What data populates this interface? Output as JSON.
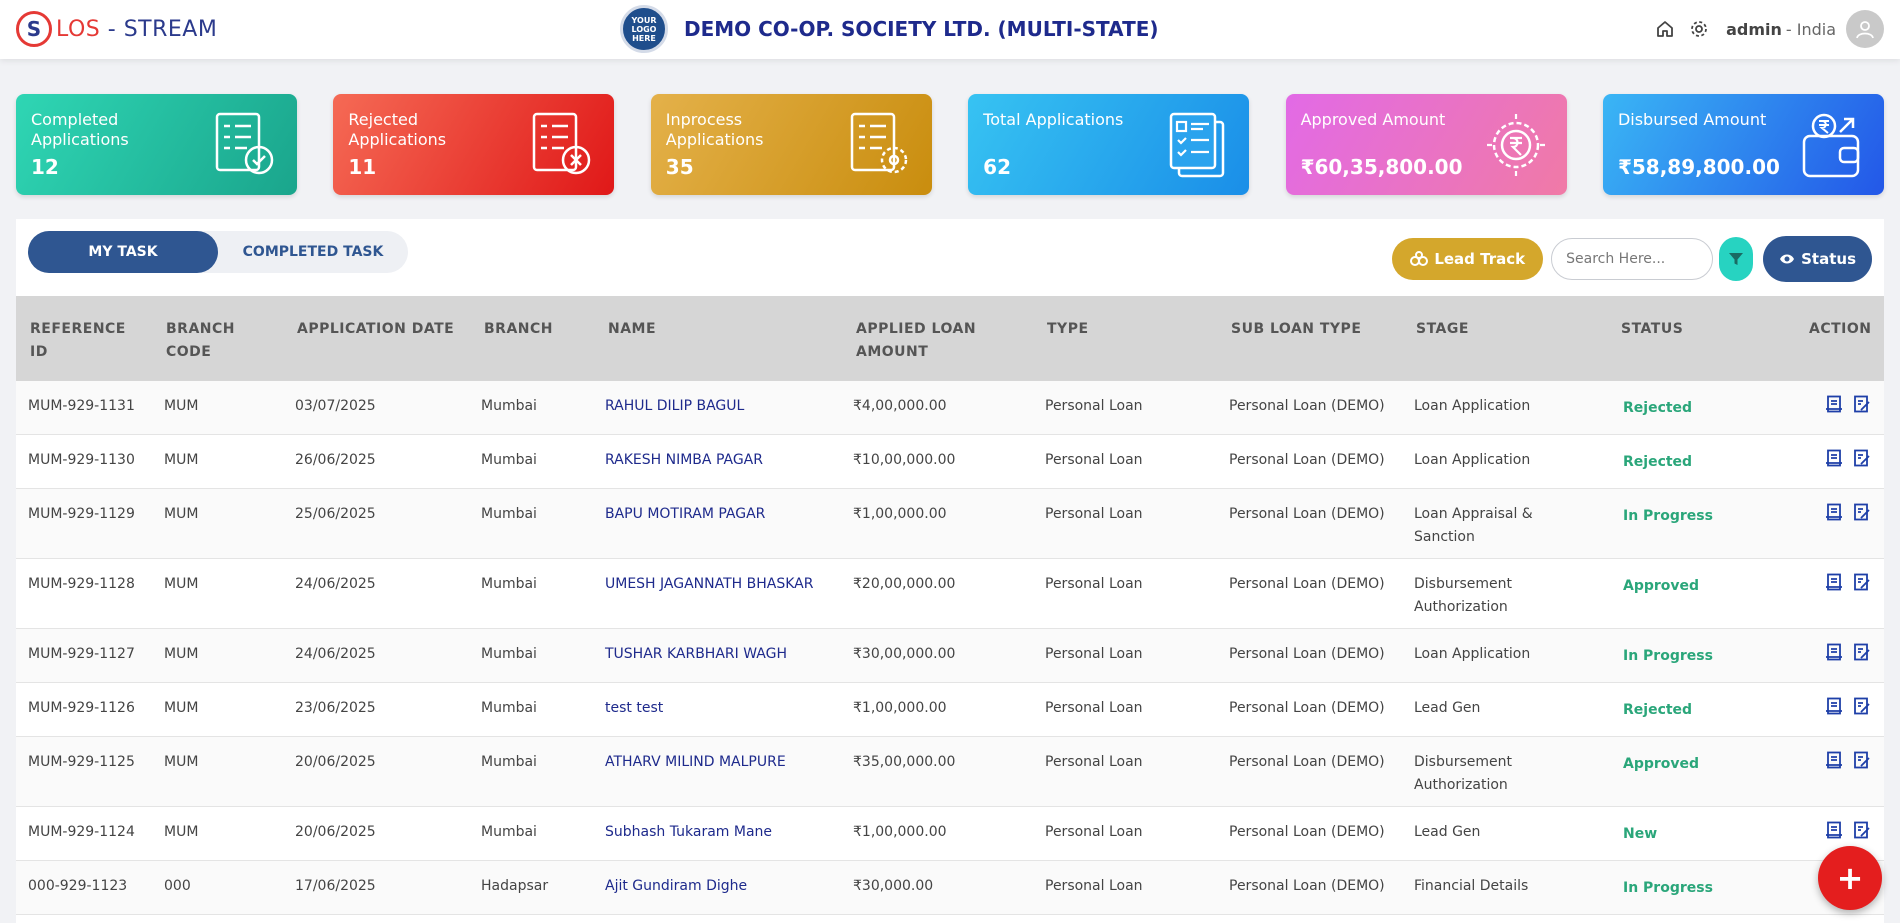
{
  "header": {
    "logo_los": "LOS",
    "logo_dash": " - ",
    "logo_stream": "STREAM",
    "badge_text": "YOUR LOGO HERE",
    "org_name": "DEMO CO-OP. SOCIETY LTD. (MULTI-STATE)",
    "user": "admin",
    "country": "- India",
    "icons": [
      "home-icon",
      "gear-icon",
      "user-avatar-icon"
    ]
  },
  "cards": [
    {
      "label": "Completed Applications",
      "value": "12",
      "icon": "checklist-check-icon",
      "gradient": [
        "#2fd6b4",
        "#1aa58c"
      ]
    },
    {
      "label": "Rejected Applications",
      "value": "11",
      "icon": "checklist-x-icon",
      "gradient": [
        "#f56a55",
        "#e01818"
      ]
    },
    {
      "label": "Inprocess Applications",
      "value": "35",
      "icon": "checklist-gear-icon",
      "gradient": [
        "#e4b14a",
        "#c98d0e"
      ]
    },
    {
      "label": "Total Applications",
      "value": "62",
      "icon": "documents-list-icon",
      "gradient": [
        "#37c3f2",
        "#1a8ee8"
      ]
    },
    {
      "label": "Approved Amount",
      "value": "₹60,35,800.00",
      "icon": "rupee-badge-icon",
      "gradient": [
        "#e26ae6",
        "#f07aa6"
      ]
    },
    {
      "label": "Disbursed Amount",
      "value": "₹58,89,800.00",
      "icon": "wallet-rupee-icon",
      "gradient": [
        "#3ab6f5",
        "#2357e8"
      ]
    }
  ],
  "tabs": {
    "my_task": "MY TASK",
    "completed_task": "COMPLETED TASK"
  },
  "toolbar": {
    "lead_track": "Lead Track",
    "search_placeholder": "Search Here...",
    "status": "Status"
  },
  "columns": [
    "REFERENCE ID",
    "BRANCH CODE",
    "APPLICATION DATE",
    "BRANCH",
    "NAME",
    "APPLIED LOAN AMOUNT",
    "TYPE",
    "SUB LOAN TYPE",
    "STAGE",
    "STATUS",
    "ACTION"
  ],
  "rows": [
    {
      "ref": "MUM-929-1131",
      "code": "MUM",
      "date": "03/07/2025",
      "branch": "Mumbai",
      "name": "RAHUL DILIP BAGUL",
      "amount": "₹4,00,000.00",
      "type": "Personal Loan",
      "sub": "Personal Loan (DEMO)",
      "stage": "Loan Application",
      "status": "Rejected"
    },
    {
      "ref": "MUM-929-1130",
      "code": "MUM",
      "date": "26/06/2025",
      "branch": "Mumbai",
      "name": "RAKESH NIMBA PAGAR",
      "amount": "₹10,00,000.00",
      "type": "Personal Loan",
      "sub": "Personal Loan (DEMO)",
      "stage": "Loan Application",
      "status": "Rejected"
    },
    {
      "ref": "MUM-929-1129",
      "code": "MUM",
      "date": "25/06/2025",
      "branch": "Mumbai",
      "name": "BAPU MOTIRAM PAGAR",
      "amount": "₹1,00,000.00",
      "type": "Personal Loan",
      "sub": "Personal Loan (DEMO)",
      "stage": "Loan Appraisal & Sanction",
      "status": "In Progress"
    },
    {
      "ref": "MUM-929-1128",
      "code": "MUM",
      "date": "24/06/2025",
      "branch": "Mumbai",
      "name": "UMESH JAGANNATH BHASKAR",
      "amount": "₹20,00,000.00",
      "type": "Personal Loan",
      "sub": "Personal Loan (DEMO)",
      "stage": "Disbursement Authorization",
      "status": "Approved"
    },
    {
      "ref": "MUM-929-1127",
      "code": "MUM",
      "date": "24/06/2025",
      "branch": "Mumbai",
      "name": "TUSHAR KARBHARI WAGH",
      "amount": "₹30,00,000.00",
      "type": "Personal Loan",
      "sub": "Personal Loan (DEMO)",
      "stage": "Loan Application",
      "status": "In Progress"
    },
    {
      "ref": "MUM-929-1126",
      "code": "MUM",
      "date": "23/06/2025",
      "branch": "Mumbai",
      "name": "test test",
      "amount": "₹1,00,000.00",
      "type": "Personal Loan",
      "sub": "Personal Loan (DEMO)",
      "stage": "Lead Gen",
      "status": "Rejected"
    },
    {
      "ref": "MUM-929-1125",
      "code": "MUM",
      "date": "20/06/2025",
      "branch": "Mumbai",
      "name": "ATHARV MILIND MALPURE",
      "amount": "₹35,00,000.00",
      "type": "Personal Loan",
      "sub": "Personal Loan (DEMO)",
      "stage": "Disbursement Authorization",
      "status": "Approved"
    },
    {
      "ref": "MUM-929-1124",
      "code": "MUM",
      "date": "20/06/2025",
      "branch": "Mumbai",
      "name": "Subhash Tukaram Mane",
      "amount": "₹1,00,000.00",
      "type": "Personal Loan",
      "sub": "Personal Loan (DEMO)",
      "stage": "Lead Gen",
      "status": "New"
    },
    {
      "ref": "000-929-1123",
      "code": "000",
      "date": "17/06/2025",
      "branch": "Hadapsar",
      "name": "Ajit Gundiram Dighe",
      "amount": "₹30,000.00",
      "type": "Personal Loan",
      "sub": "Personal Loan (DEMO)",
      "stage": "Financial Details",
      "status": "In Progress"
    }
  ],
  "fab_label": "+"
}
